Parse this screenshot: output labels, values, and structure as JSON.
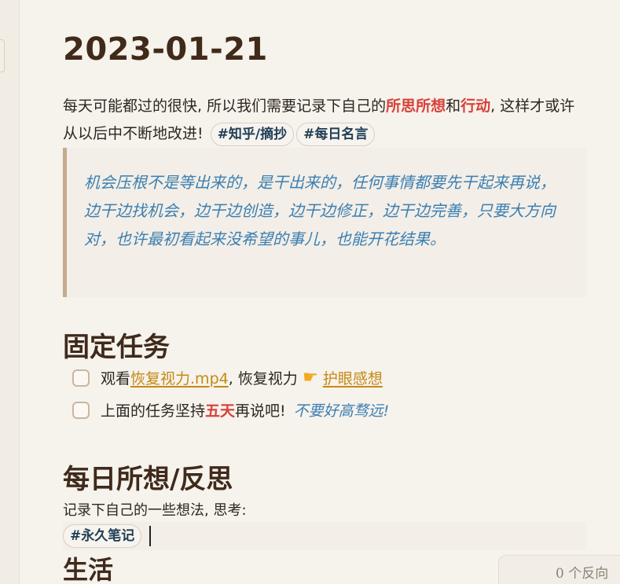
{
  "page": {
    "title": "2023-01-21"
  },
  "intro": {
    "prefix": "每天可能都过的很快, 所以我们需要记录下自己的",
    "highlight1": "所思所想",
    "middle": "和",
    "highlight2": "行动",
    "suffix": ", 这样才或许从以后中不断地改进!",
    "tags": [
      "#知乎/摘抄",
      "#每日名言"
    ]
  },
  "quote": {
    "text": "机会压根不是等出来的，是干出来的，任何事情都要先干起来再说，边干边找机会，边干边创造，边干边修正，边干边完善，只要大方向对，也许最初看起来没希望的事儿，也能开花结果。"
  },
  "sections": {
    "fixed_tasks": "固定任务",
    "daily_thoughts": "每日所想/反思",
    "life": "生活"
  },
  "tasks": [
    {
      "prefix": "观看",
      "link": "恢复视力.mp4",
      "middle": ", 恢复视力",
      "icon": "pointing-hand-icon",
      "link2": "护眼感想"
    },
    {
      "prefix": "上面的任务坚持",
      "highlight": "五天",
      "middle": "再说吧!",
      "italic": "不要好高骛远!"
    }
  ],
  "daily": {
    "note": "记录下自己的一些想法, 思考:",
    "tag": "#永久笔记"
  },
  "footer": {
    "backlinks": "0 个反向"
  },
  "colors": {
    "accent_red": "#d8403a",
    "quote_blue": "#3a7fb2",
    "link_gold": "#c48a14",
    "heading_brown": "#3f2a1b"
  }
}
